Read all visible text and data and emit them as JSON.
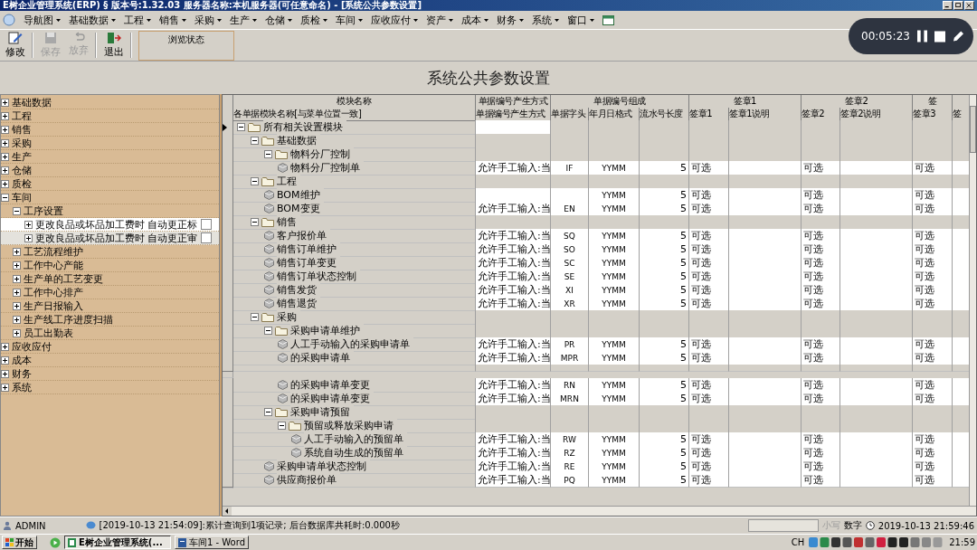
{
  "window": {
    "title": "E树企业管理系统(ERP) § 版本号:1.32.03   服务器名称:本机服务器(可任意命名) - [系统公共参数设置]"
  },
  "menu": [
    {
      "label": "导航图"
    },
    {
      "label": "基础数据"
    },
    {
      "label": "工程"
    },
    {
      "label": "销售"
    },
    {
      "label": "采购"
    },
    {
      "label": "生产"
    },
    {
      "label": "仓储"
    },
    {
      "label": "质检"
    },
    {
      "label": "车间"
    },
    {
      "label": "应收应付"
    },
    {
      "label": "资产"
    },
    {
      "label": "成本"
    },
    {
      "label": "财务"
    },
    {
      "label": "系统"
    },
    {
      "label": "窗口"
    }
  ],
  "toolbar": [
    {
      "kind": "edit",
      "label": "修改",
      "disabled": false
    },
    {
      "kind": "save",
      "label": "保存",
      "disabled": true
    },
    {
      "kind": "undo",
      "label": "放弃",
      "disabled": true
    },
    {
      "kind": "exit",
      "label": "退出",
      "disabled": false
    }
  ],
  "mode_panel": "浏览状态",
  "heading": "系统公共参数设置",
  "recording": {
    "time": "00:05:23"
  },
  "sidebar": {
    "items": [
      {
        "label": "基础数据",
        "expanded": false
      },
      {
        "label": "工程",
        "expanded": false
      },
      {
        "label": "销售",
        "expanded": false
      },
      {
        "label": "采购",
        "expanded": false
      },
      {
        "label": "生产",
        "expanded": false
      },
      {
        "label": "仓储",
        "expanded": false
      },
      {
        "label": "质检",
        "expanded": false
      },
      {
        "label": "车间",
        "expanded": true,
        "children": [
          {
            "label": "工序设置",
            "expanded": true,
            "children": [
              {
                "kind": "option",
                "label": "更改良品或坏品加工费时 自动更正标",
                "expanded": false,
                "checked": false,
                "selected": true
              },
              {
                "kind": "option",
                "label": "更改良品或坏品加工费时 自动更正审",
                "expanded": false,
                "checked": false,
                "selected": false
              }
            ]
          },
          {
            "label": "工艺流程维护",
            "expanded": false
          },
          {
            "label": "工作中心产能",
            "expanded": false
          },
          {
            "label": "生产单的工艺变更",
            "expanded": false
          },
          {
            "label": "工作中心排产",
            "expanded": false
          },
          {
            "label": "生产日报输入",
            "expanded": false
          },
          {
            "label": "生产线工序进度扫描",
            "expanded": false
          },
          {
            "label": "员工出勤表",
            "expanded": false
          }
        ]
      },
      {
        "label": "应收应付",
        "expanded": false
      },
      {
        "label": "成本",
        "expanded": false
      },
      {
        "label": "财务",
        "expanded": false
      },
      {
        "label": "系统",
        "expanded": false
      }
    ]
  },
  "grid": {
    "group_headers": [
      "模块名称",
      "单据编号产生方式",
      "单据编号组成",
      "签章1",
      "签章2",
      "签"
    ],
    "columns": [
      "各单据模块名称[与菜单位置一致]",
      "单据编号产生方式",
      "单据字头",
      "年月日格式",
      "流水号长度",
      "签章1",
      "签章1说明",
      "签章2",
      "签章2说明",
      "签章3",
      "签"
    ],
    "rows": [
      {
        "kind": "folder",
        "name": "所有相关设置模块",
        "expanded": true,
        "current": true,
        "children": [
          {
            "kind": "folder",
            "name": "基础数据",
            "expanded": true,
            "current": false,
            "children": [
              {
                "kind": "folder",
                "name": "物料分厂控制",
                "expanded": true,
                "current": false,
                "children": [
                  {
                    "kind": "doc",
                    "name": "物料分厂控制单",
                    "current": false,
                    "cells": [
                      "允许手工输入:当",
                      "IF",
                      "YYMM",
                      "5",
                      "可选",
                      null,
                      "可选",
                      null,
                      "可选",
                      null
                    ]
                  }
                ]
              }
            ]
          },
          {
            "kind": "folder",
            "name": "工程",
            "expanded": true,
            "current": false,
            "children": [
              {
                "kind": "doc",
                "name": "BOM维护",
                "current": false,
                "cells": [
                  null,
                  null,
                  "YYMM",
                  "5",
                  "可选",
                  null,
                  "可选",
                  null,
                  "可选",
                  null
                ]
              },
              {
                "kind": "doc",
                "name": "BOM变更",
                "current": false,
                "cells": [
                  "允许手工输入:当",
                  "EN",
                  "YYMM",
                  "5",
                  "可选",
                  null,
                  "可选",
                  null,
                  "可选",
                  null
                ]
              }
            ]
          },
          {
            "kind": "folder",
            "name": "销售",
            "expanded": true,
            "current": false,
            "children": [
              {
                "kind": "doc",
                "name": "客户报价单",
                "current": false,
                "cells": [
                  "允许手工输入:当",
                  "SQ",
                  "YYMM",
                  "5",
                  "可选",
                  null,
                  "可选",
                  null,
                  "可选",
                  null
                ]
              },
              {
                "kind": "doc",
                "name": "销售订单维护",
                "current": false,
                "cells": [
                  "允许手工输入:当",
                  "SO",
                  "YYMM",
                  "5",
                  "可选",
                  null,
                  "可选",
                  null,
                  "可选",
                  null
                ]
              },
              {
                "kind": "doc",
                "name": "销售订单变更",
                "current": false,
                "cells": [
                  "允许手工输入:当",
                  "SC",
                  "YYMM",
                  "5",
                  "可选",
                  null,
                  "可选",
                  null,
                  "可选",
                  null
                ]
              },
              {
                "kind": "doc",
                "name": "销售订单状态控制",
                "current": false,
                "cells": [
                  "允许手工输入:当",
                  "SE",
                  "YYMM",
                  "5",
                  "可选",
                  null,
                  "可选",
                  null,
                  "可选",
                  null
                ]
              },
              {
                "kind": "doc",
                "name": "销售发货",
                "current": false,
                "cells": [
                  "允许手工输入:当",
                  "XI",
                  "YYMM",
                  "5",
                  "可选",
                  null,
                  "可选",
                  null,
                  "可选",
                  null
                ]
              },
              {
                "kind": "doc",
                "name": "销售退货",
                "current": false,
                "cells": [
                  "允许手工输入:当",
                  "XR",
                  "YYMM",
                  "5",
                  "可选",
                  null,
                  "可选",
                  null,
                  "可选",
                  null
                ]
              }
            ]
          },
          {
            "kind": "folder",
            "name": "采购",
            "expanded": true,
            "current": false,
            "children": [
              {
                "kind": "folder",
                "name": "采购申请单维护",
                "expanded": true,
                "current": false,
                "children": [
                  {
                    "kind": "doc",
                    "name": "人工手动输入的采购申请单",
                    "current": false,
                    "cells": [
                      "允许手工输入:当",
                      "PR",
                      "YYMM",
                      "5",
                      "可选",
                      null,
                      "可选",
                      null,
                      "可选",
                      null
                    ]
                  },
                  {
                    "kind": "doc",
                    "name": "的采购申请单",
                    "current": false,
                    "cells": [
                      "允许手工输入:当",
                      "MPR",
                      "YYMM",
                      "5",
                      "可选",
                      null,
                      "可选",
                      null,
                      "可选",
                      null
                    ]
                  },
                  {
                    "kind": "blank",
                    "current": false
                  },
                  {
                    "kind": "doc",
                    "name": "的采购申请单变更",
                    "current": false,
                    "cells": [
                      "允许手工输入:当",
                      "RN",
                      "YYMM",
                      "5",
                      "可选",
                      null,
                      "可选",
                      null,
                      "可选",
                      null
                    ]
                  },
                  {
                    "kind": "doc",
                    "name": "的采购申请单变更",
                    "current": false,
                    "cells": [
                      "允许手工输入:当",
                      "MRN",
                      "YYMM",
                      "5",
                      "可选",
                      null,
                      "可选",
                      null,
                      "可选",
                      null
                    ]
                  }
                ]
              },
              {
                "kind": "folder",
                "name": "采购申请预留",
                "expanded": true,
                "current": false,
                "children": [
                  {
                    "kind": "folder",
                    "name": "预留或释放采购申请",
                    "expanded": true,
                    "current": false,
                    "children": [
                      {
                        "kind": "doc",
                        "name": "人工手动输入的预留单",
                        "current": false,
                        "cells": [
                          "允许手工输入:当",
                          "RW",
                          "YYMM",
                          "5",
                          "可选",
                          null,
                          "可选",
                          null,
                          "可选",
                          null
                        ]
                      },
                      {
                        "kind": "doc",
                        "name": "系统自动生成的预留单",
                        "current": false,
                        "cells": [
                          "允许手工输入:当",
                          "RZ",
                          "YYMM",
                          "5",
                          "可选",
                          null,
                          "可选",
                          null,
                          "可选",
                          null
                        ]
                      }
                    ]
                  }
                ]
              },
              {
                "kind": "doc",
                "name": "采购申请单状态控制",
                "current": false,
                "cells": [
                  "允许手工输入:当",
                  "RE",
                  "YYMM",
                  "5",
                  "可选",
                  null,
                  "可选",
                  null,
                  "可选",
                  null
                ]
              },
              {
                "kind": "doc",
                "name": "供应商报价单",
                "current": false,
                "cells": [
                  "允许手工输入:当",
                  "PQ",
                  "YYMM",
                  "5",
                  "可选",
                  null,
                  "可选",
                  null,
                  "可选",
                  null
                ]
              }
            ]
          }
        ]
      }
    ]
  },
  "status_bar": {
    "user": "ADMIN",
    "message": "[2019-10-13 21:54:09]:累计查询到1项记录; 后台数据库共耗时:0.000秒",
    "caps": {
      "label": "小写",
      "disabled": true
    },
    "num": {
      "label": "数字",
      "disabled": false
    },
    "datetime": "2019-10-13 21:59:46"
  },
  "taskbar": {
    "start": "开始",
    "tasks": [
      {
        "kind": "app",
        "label": "E树企业管理系统(...",
        "selected": true
      },
      {
        "kind": "word",
        "label": "车间1 - Word",
        "selected": false
      }
    ],
    "language": "CH",
    "clock": "21:59"
  }
}
